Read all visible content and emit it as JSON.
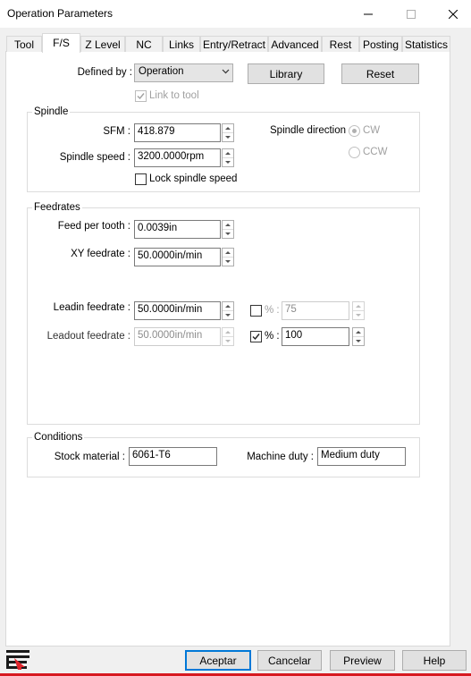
{
  "window": {
    "title": "Operation Parameters"
  },
  "tabs": [
    "Tool",
    "F/S",
    "Z Level",
    "NC",
    "Links",
    "Entry/Retract",
    "Advanced",
    "Rest",
    "Posting",
    "Statistics"
  ],
  "top": {
    "defined_by_label": "Defined by :",
    "defined_by_value": "Operation",
    "library_button": "Library",
    "reset_button": "Reset",
    "link_to_tool_label": "Link to tool"
  },
  "spindle": {
    "group_label": "Spindle",
    "sfm_label": "SFM :",
    "sfm_value": "418.879",
    "speed_label": "Spindle speed :",
    "speed_value": "3200.0000rpm",
    "lock_label": "Lock spindle speed",
    "direction_label": "Spindle direction :",
    "cw_label": "CW",
    "ccw_label": "CCW"
  },
  "feedrates": {
    "group_label": "Feedrates",
    "feed_per_tooth_label": "Feed per tooth :",
    "feed_per_tooth_value": "0.0039in",
    "xy_label": "XY feedrate :",
    "xy_value": "50.0000in/min",
    "leadin_label": "Leadin feedrate :",
    "leadin_value": "50.0000in/min",
    "leadin_pct_label": "% :",
    "leadin_pct_value": "75",
    "leadout_label": "Leadout feedrate :",
    "leadout_value": "50.0000in/min",
    "leadout_pct_label": "% :",
    "leadout_pct_value": "100"
  },
  "conditions": {
    "group_label": "Conditions",
    "stock_label": "Stock material :",
    "stock_value": "6061-T6",
    "duty_label": "Machine duty :",
    "duty_value": "Medium duty"
  },
  "footer": {
    "ok_button": "Aceptar",
    "cancel_button": "Cancelar",
    "preview_button": "Preview",
    "help_button": "Help"
  },
  "colors": {
    "accent": "#0078d7",
    "status_red": "#d71920"
  }
}
